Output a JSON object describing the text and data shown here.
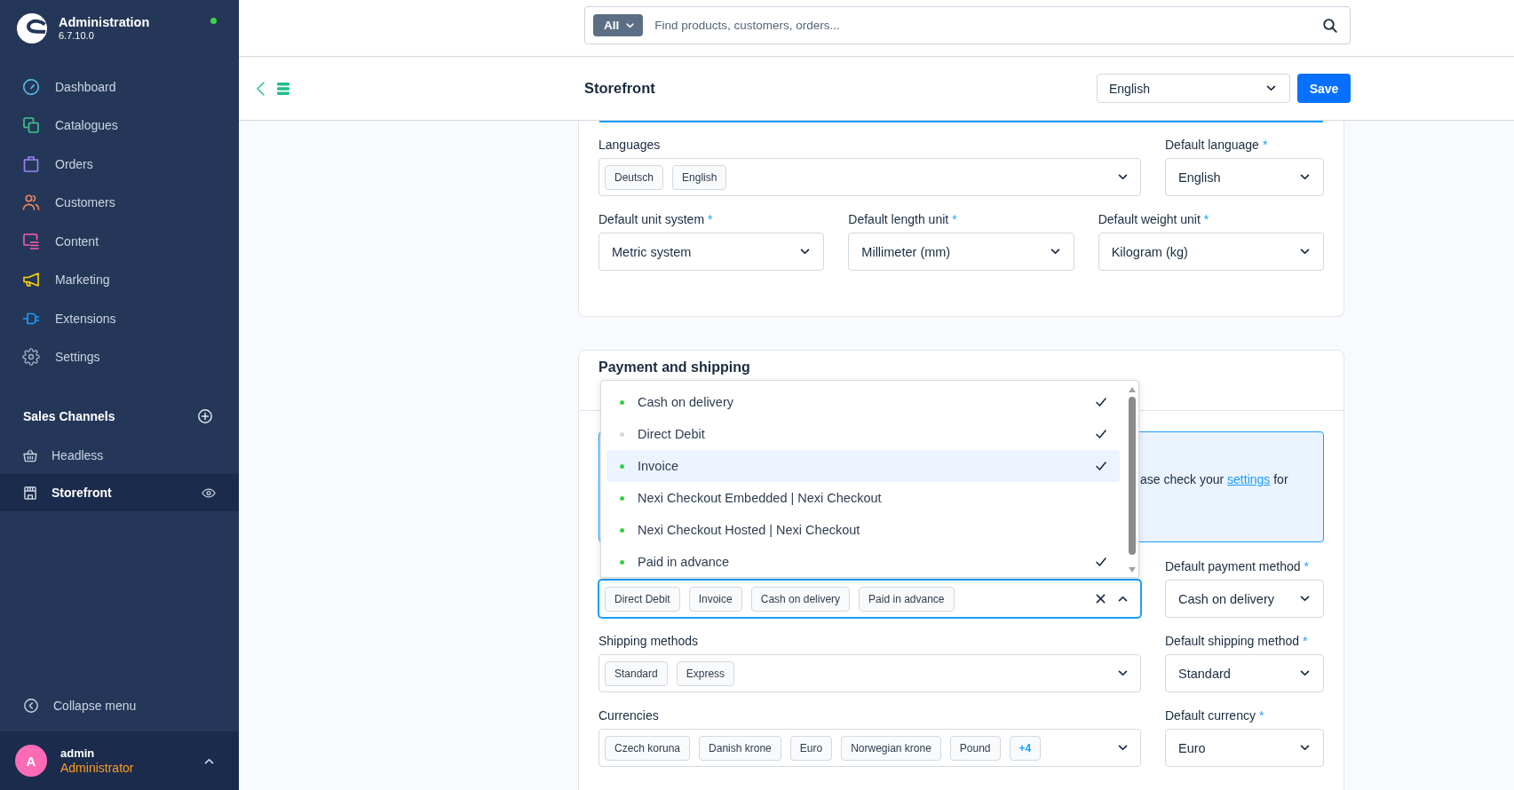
{
  "sidebar": {
    "header": {
      "title": "Administration",
      "version": "6.7.10.0"
    },
    "nav": [
      {
        "label": "Dashboard"
      },
      {
        "label": "Catalogues"
      },
      {
        "label": "Orders"
      },
      {
        "label": "Customers"
      },
      {
        "label": "Content"
      },
      {
        "label": "Marketing"
      },
      {
        "label": "Extensions"
      },
      {
        "label": "Settings"
      }
    ],
    "sales_channels": {
      "title": "Sales Channels",
      "items": [
        {
          "label": "Headless",
          "selected": false,
          "preview": false
        },
        {
          "label": "Storefront",
          "selected": true,
          "preview": true
        }
      ]
    },
    "collapse": "Collapse menu",
    "user": {
      "initial": "A",
      "name": "admin",
      "role": "Administrator"
    }
  },
  "search": {
    "scope": "All",
    "placeholder": "Find products, customers, orders..."
  },
  "smart_bar": {
    "title": "Storefront",
    "language": "English",
    "save": "Save"
  },
  "locale_card": {
    "rows": [
      [
        {
          "kind": "multi",
          "label": "Languages",
          "expanded": false,
          "tags": [
            "Deutsch",
            "English"
          ]
        },
        {
          "kind": "select",
          "label": "Default language",
          "required_mark": "*",
          "value": "English",
          "expanded": false
        }
      ],
      [
        {
          "kind": "select",
          "label": "Default unit system",
          "required_mark": "*",
          "value": "Metric system",
          "expanded": false
        },
        {
          "kind": "select",
          "label": "Default length unit",
          "required_mark": "*",
          "value": "Millimeter (mm)",
          "expanded": false
        },
        {
          "kind": "select",
          "label": "Default weight unit",
          "required_mark": "*",
          "value": "Kilogram (kg)",
          "expanded": false
        }
      ]
    ]
  },
  "payment_card": {
    "title": "Payment and shipping",
    "alert": {
      "text": "ase check your",
      "link": "settings",
      "text_after": "for"
    },
    "rows": [
      [
        {
          "kind": "multi",
          "expanded": true,
          "tags": [
            "Direct Debit",
            "Invoice",
            "Cash on delivery",
            "Paid in advance"
          ],
          "options": [
            {
              "label": "Cash on delivery",
              "color": "#37d046",
              "checked": true,
              "highlighted": false
            },
            {
              "label": "Direct Debit",
              "color": "#d1d9e0",
              "checked": true,
              "highlighted": false
            },
            {
              "label": "Invoice",
              "color": "#37d046",
              "checked": true,
              "highlighted": true
            },
            {
              "label": "Nexi Checkout Embedded | Nexi Checkout",
              "color": "#37d046",
              "checked": false,
              "highlighted": false
            },
            {
              "label": "Nexi Checkout Hosted | Nexi Checkout",
              "color": "#37d046",
              "checked": false,
              "highlighted": false
            },
            {
              "label": "Paid in advance",
              "color": "#37d046",
              "checked": true,
              "highlighted": false
            }
          ]
        },
        {
          "kind": "select",
          "label": "Default payment method",
          "required_mark": "*",
          "value": "Cash on delivery",
          "expanded": false
        }
      ],
      [
        {
          "kind": "multi",
          "label": "Shipping methods",
          "expanded": false,
          "tags": [
            "Standard",
            "Express"
          ]
        },
        {
          "kind": "select",
          "label": "Default shipping method",
          "required_mark": "*",
          "value": "Standard",
          "expanded": false
        }
      ],
      [
        {
          "kind": "multi",
          "label": "Currencies",
          "expanded": false,
          "tags": [
            "Czech koruna",
            "Danish krone",
            "Euro",
            "Norwegian krone",
            "Pound"
          ],
          "more": "+4"
        },
        {
          "kind": "select",
          "label": "Default currency",
          "required_mark": "*",
          "value": "Euro",
          "expanded": false
        }
      ]
    ]
  }
}
